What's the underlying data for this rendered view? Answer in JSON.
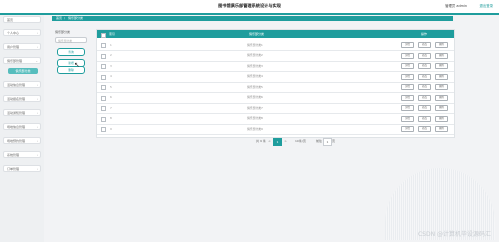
{
  "header": {
    "title": "图书馆俱乐部管理系统设计与实现",
    "user_info": "管理员 admin",
    "logout": "退出登录"
  },
  "sidebar": {
    "items": [
      {
        "label": "首页",
        "active": false
      },
      {
        "label": "个人中心",
        "active": false
      },
      {
        "label": "用户管理",
        "active": false
      },
      {
        "label": "俱乐部管理",
        "active": true
      },
      {
        "label": "活动信息管理",
        "active": false
      },
      {
        "label": "活动报名管理",
        "active": false
      },
      {
        "label": "活动通知管理",
        "active": false
      },
      {
        "label": "场地信息管理",
        "active": false
      },
      {
        "label": "场地预约管理",
        "active": false
      },
      {
        "label": "系统管理",
        "active": false
      },
      {
        "label": "订单管理",
        "active": false
      }
    ],
    "sub_item": "俱乐部分类"
  },
  "breadcrumb": {
    "home": "首页",
    "current": "俱乐部分类"
  },
  "search": {
    "label": "俱乐部分类",
    "placeholder": "俱乐部分类",
    "search_button": "查询",
    "add_button": "新增",
    "delete_button": "删除"
  },
  "table": {
    "columns": {
      "index": "索引",
      "name": "俱乐部分类",
      "actions": "操作"
    },
    "rows": [
      {
        "index": "1",
        "name": "俱乐部分类1"
      },
      {
        "index": "2",
        "name": "俱乐部分类2"
      },
      {
        "index": "3",
        "name": "俱乐部分类3"
      },
      {
        "index": "4",
        "name": "俱乐部分类4"
      },
      {
        "index": "5",
        "name": "俱乐部分类5"
      },
      {
        "index": "6",
        "name": "俱乐部分类6"
      },
      {
        "index": "7",
        "name": "俱乐部分类7"
      },
      {
        "index": "8",
        "name": "俱乐部分类8"
      },
      {
        "index": "9",
        "name": "俱乐部分类9"
      }
    ],
    "row_actions": {
      "detail": "详情",
      "edit": "修改",
      "delete": "删除"
    }
  },
  "pagination": {
    "total": "共 9 条",
    "prev": "<",
    "current_page": "1",
    "next": ">",
    "page_size": "10条/页",
    "goto_label": "前往",
    "goto_value": "1",
    "goto_suffix": "页"
  },
  "watermark": "CSDN @计算机毕设源码汇",
  "colors": {
    "accent": "#1f9d9d",
    "background": "#f2f3f5"
  }
}
